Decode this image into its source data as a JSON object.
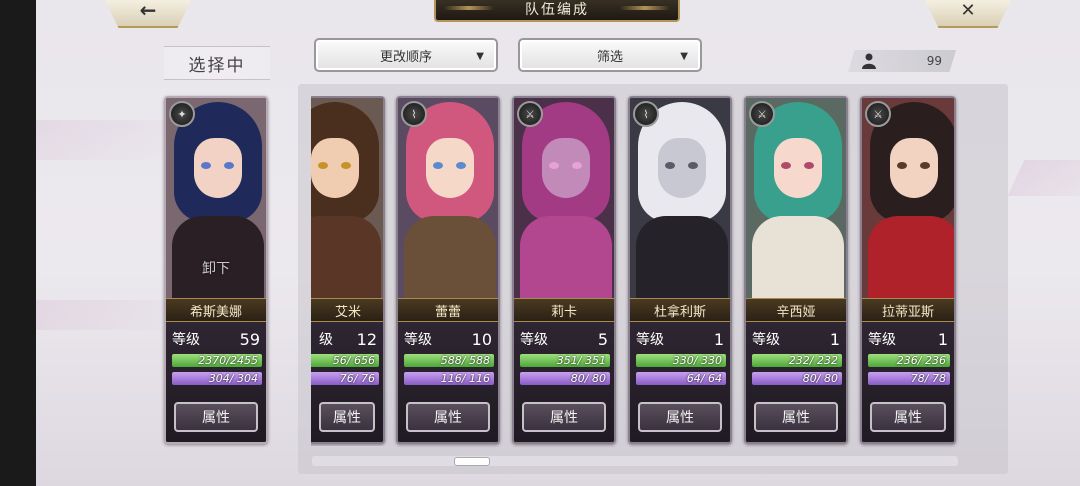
{
  "header": {
    "title": "队伍编成",
    "back_icon": "←",
    "close_icon": "✕"
  },
  "selecting_label": "选择中",
  "sort_dropdown": {
    "label": "更改顺序",
    "arrow": "▼"
  },
  "filter_dropdown": {
    "label": "筛选",
    "arrow": "▼"
  },
  "unit_count": "99",
  "level_label": "等级",
  "attribute_button": "属性",
  "leader_card": {
    "name": "希斯美娜",
    "level": "59",
    "hp": "2370/2455",
    "mp": "304/ 304",
    "overlay_text": "卸下",
    "class_icon": "✦",
    "hair": "#1f2a5a",
    "skin": "#f1d2c4",
    "body": "#2b1f26",
    "bg": "#7a6770",
    "eye": "#5a78c8"
  },
  "cards": [
    {
      "name": "艾米",
      "level_label": "级",
      "level": "12",
      "hp": "56/ 656",
      "mp": "76/ 76",
      "class_icon": "✦",
      "hair": "#4a2e1e",
      "skin": "#f0cdb0",
      "body": "#5a3626",
      "bg": "#6a5a52",
      "eye": "#c8922a"
    },
    {
      "name": "蕾蕾",
      "level": "10",
      "hp": "588/ 588",
      "mp": "116/ 116",
      "class_icon": "⌇",
      "hair": "#d0587e",
      "skin": "#f6d8c8",
      "body": "#6a5038",
      "bg": "#5a4a62",
      "eye": "#5a8ad0"
    },
    {
      "name": "莉卡",
      "level": "5",
      "hp": "351/ 351",
      "mp": "80/ 80",
      "class_icon": "⚔",
      "hair": "#a23a84",
      "skin": "#c28ab8",
      "body": "#b3478f",
      "bg": "#4a3048",
      "eye": "#e8a0d8"
    },
    {
      "name": "杜拿利斯",
      "level": "1",
      "hp": "330/ 330",
      "mp": "64/ 64",
      "class_icon": "⌇",
      "hair": "#e8e8ee",
      "skin": "#c8c8d2",
      "body": "#26222a",
      "bg": "#3a3a44",
      "eye": "#5a5a6a"
    },
    {
      "name": "辛西娅",
      "level": "1",
      "hp": "232/ 232",
      "mp": "80/ 80",
      "class_icon": "⚔",
      "hair": "#3aa08e",
      "skin": "#f6d8cc",
      "body": "#e8e2d6",
      "bg": "#5a6a62",
      "eye": "#b04a6a"
    },
    {
      "name": "拉蒂亚斯",
      "level": "1",
      "hp": "236/ 236",
      "mp": "78/ 78",
      "class_icon": "⚔",
      "hair": "#2a1e1e",
      "skin": "#f2d2c0",
      "body": "#b0222a",
      "bg": "#6a3a3a",
      "eye": "#5a3a2a"
    }
  ]
}
